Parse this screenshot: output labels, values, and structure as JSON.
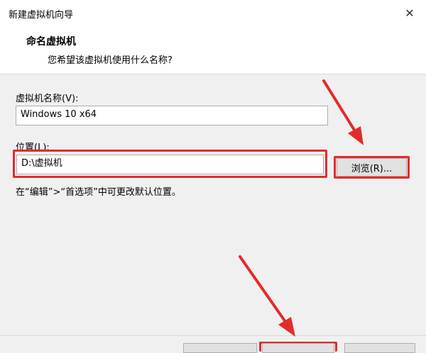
{
  "window": {
    "title": "新建虚拟机向导",
    "close_glyph": "✕"
  },
  "header": {
    "title": "命名虚拟机",
    "subtitle": "您希望该虚拟机使用什么名称?"
  },
  "name_field": {
    "label": "虚拟机名称(V):",
    "value": "Windows 10 x64"
  },
  "location_field": {
    "label": "位置(L):",
    "value": "D:\\虚拟机"
  },
  "browse_button": {
    "label": "浏览(R)..."
  },
  "hint": "在“编辑”>“首选项”中可更改默认位置。",
  "annotation_color": "#e32b2b"
}
